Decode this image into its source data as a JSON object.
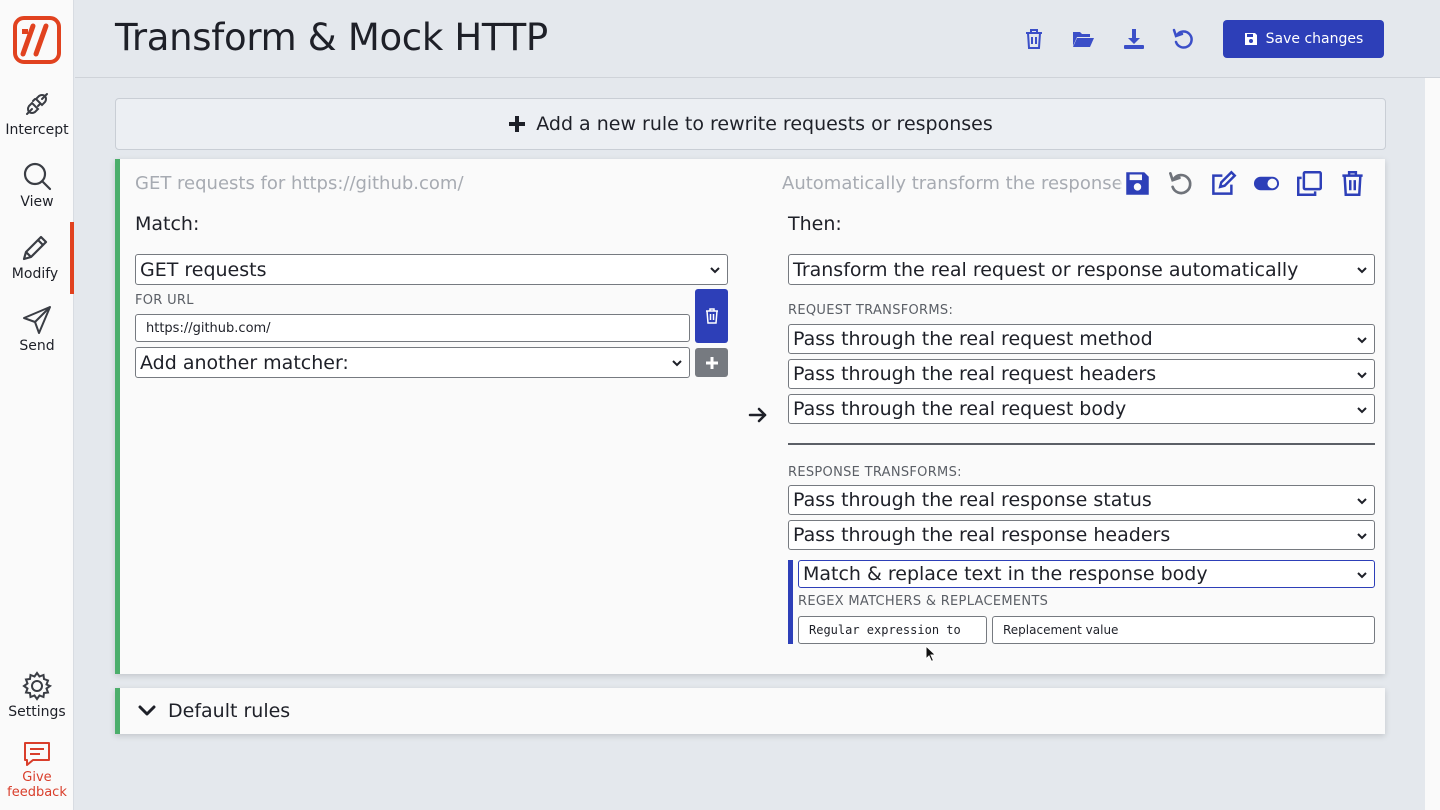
{
  "app": {
    "title": "Transform & Mock HTTP"
  },
  "sidebar": {
    "items": [
      {
        "label": "Intercept",
        "icon": "plug-icon"
      },
      {
        "label": "View",
        "icon": "search-icon"
      },
      {
        "label": "Modify",
        "icon": "pencil-icon"
      },
      {
        "label": "Send",
        "icon": "paper-plane-icon"
      }
    ],
    "bottom": [
      {
        "label": "Settings",
        "icon": "gear-icon"
      },
      {
        "label": "Give feedback",
        "line1": "Give",
        "line2": "feedback",
        "icon": "feedback-icon"
      }
    ],
    "colors": {
      "accent": "#e1421f",
      "feedback": "#d93e2b"
    }
  },
  "header": {
    "save_label": "Save changes",
    "icons": [
      "trash-icon",
      "folder-open-icon",
      "download-icon",
      "undo-icon"
    ]
  },
  "add_rule": {
    "label": "Add a new rule to rewrite requests or responses"
  },
  "rule": {
    "title_left": "GET requests for https://github.com/",
    "title_right": "Automatically transform the response",
    "match_label": "Match:",
    "method_select": "GET requests",
    "for_url_label": "FOR URL",
    "url_value": "https://github.com/",
    "add_matcher_select": "Add another matcher:",
    "then_label": "Then:",
    "action_select": "Transform the real request or response automatically",
    "request_transforms_label": "REQUEST TRANSFORMS:",
    "request_transforms": [
      "Pass through the real request method",
      "Pass through the real request headers",
      "Pass through the real request body"
    ],
    "response_transforms_label": "RESPONSE TRANSFORMS:",
    "response_transforms": [
      "Pass through the real response status",
      "Pass through the real response headers",
      "Match & replace text in the response body"
    ],
    "regex_label": "REGEX MATCHERS & REPLACEMENTS",
    "regex_placeholder": "Regular expression to",
    "replacement_placeholder": "Replacement value",
    "card_icons": [
      "save-icon",
      "undo-icon",
      "edit-icon",
      "toggle-on-icon",
      "clone-icon",
      "trash-icon"
    ]
  },
  "default_rules": {
    "label": "Default rules"
  },
  "colors": {
    "primary": "#2d3fb8",
    "rule_border": "#4cae6b",
    "background": "#e4e8ed"
  }
}
